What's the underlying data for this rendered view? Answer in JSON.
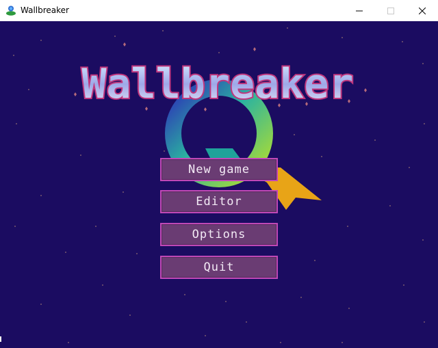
{
  "window": {
    "title": "Wallbreaker",
    "controls": [
      "minimize-icon",
      "maximize-icon",
      "close-icon"
    ]
  },
  "game": {
    "logo_text": "Wallbreaker",
    "menu": {
      "new_game": "New game",
      "editor": "Editor",
      "options": "Options",
      "quit": "Quit"
    }
  },
  "colors": {
    "background": "#1b0c61",
    "button_fill": "#6a3c73",
    "button_border": "#c048b7",
    "button_text": "#f3eaf5",
    "logo_outline": "#c0367d",
    "lightning": "#e8a417"
  }
}
